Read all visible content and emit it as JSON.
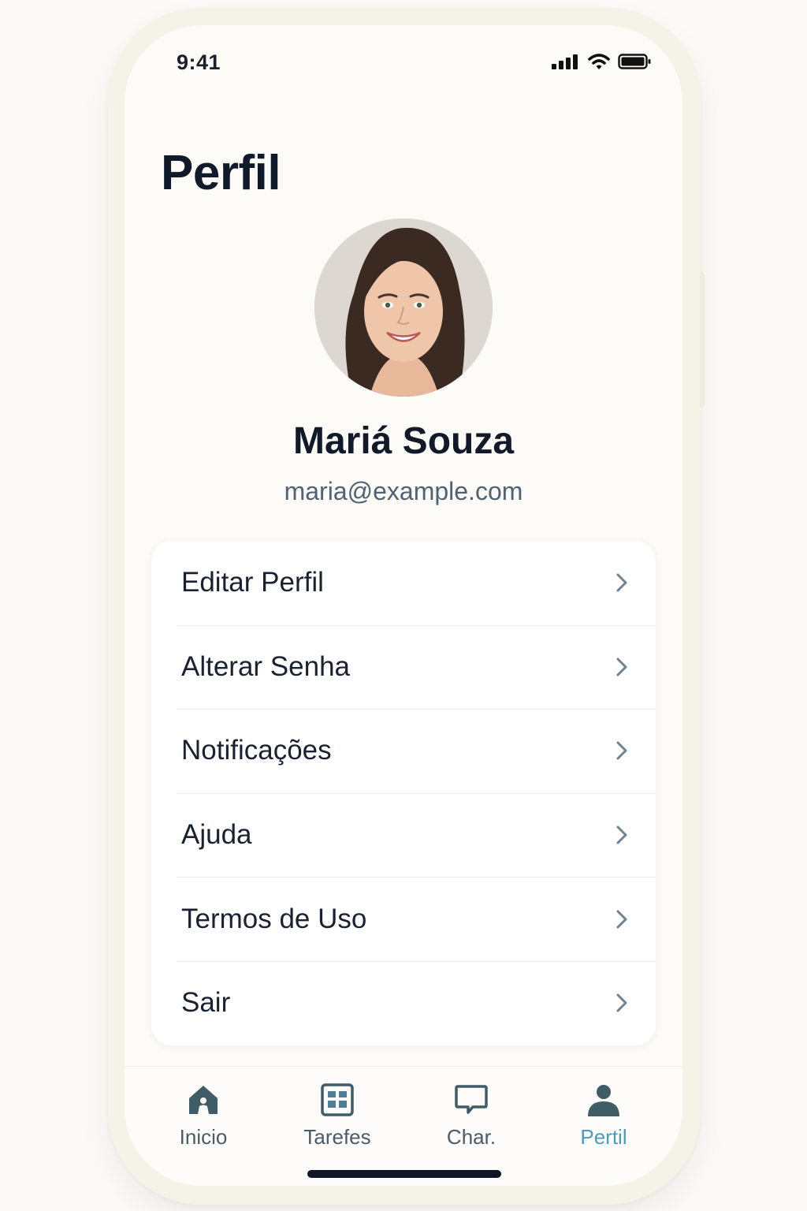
{
  "status_bar": {
    "time": "9:41",
    "icons": [
      "signal-icon",
      "wifi-icon",
      "battery-icon"
    ]
  },
  "page": {
    "title": "Perfil"
  },
  "profile": {
    "avatar_icon": "user-photo",
    "name": "Mariá Souza",
    "email": "maria@example.com"
  },
  "menu": {
    "items": [
      {
        "label": "Editar Perfil",
        "icon": "chevron-right-icon"
      },
      {
        "label": "Alterar Senha",
        "icon": "chevron-right-icon"
      },
      {
        "label": "Notificações",
        "icon": "chevron-right-icon"
      },
      {
        "label": "Ajuda",
        "icon": "chevron-right-icon"
      },
      {
        "label": "Termos de Uso",
        "icon": "chevron-right-icon"
      },
      {
        "label": "Sair",
        "icon": "chevron-right-icon"
      }
    ]
  },
  "tab_bar": {
    "tabs": [
      {
        "label": "Inicio",
        "icon": "home-icon",
        "active": false
      },
      {
        "label": "Tarefes",
        "icon": "tasks-icon",
        "active": false
      },
      {
        "label": "Char.",
        "icon": "chat-icon",
        "active": false
      },
      {
        "label": "Pertil",
        "icon": "person-icon",
        "active": true
      }
    ]
  },
  "colors": {
    "background": "#fbfaf6",
    "screen": "#fcfbf7",
    "text_primary": "#111a2b",
    "text_secondary": "#4f6374",
    "accent": "#4a9bbd",
    "chevron": "#6f8392",
    "tab_icon": "#3f5c67"
  }
}
